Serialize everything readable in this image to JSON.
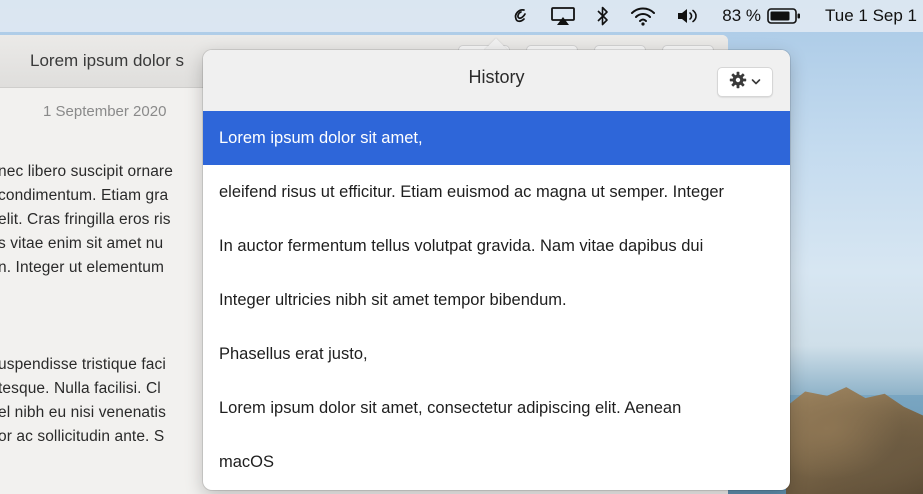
{
  "menubar": {
    "icons": [
      "clipboard-app-icon",
      "airplay-icon",
      "bluetooth-icon",
      "wifi-icon",
      "volume-icon",
      "battery-icon"
    ],
    "battery_percent": "83 %",
    "clock": "Tue 1 Sep 1"
  },
  "document": {
    "title": "Lorem ipsum dolor s",
    "date": "1 September 2020",
    "lines": [
      "nec libero suscipit ornare",
      "condimentum. Etiam gra",
      "elit. Cras fringilla eros ris",
      "s vitae enim sit amet nu",
      "n. Integer ut elementum",
      "uspendisse tristique faci",
      "tesque. Nulla facilisi. Cl",
      "el nibh eu nisi venenatis",
      "or ac sollicitudin ante. S"
    ]
  },
  "popover": {
    "title": "History",
    "items": [
      "Lorem ipsum dolor sit amet,",
      "eleifend risus ut efficitur. Etiam euismod ac magna ut semper. Integer",
      "In auctor fermentum tellus volutpat gravida. Nam vitae dapibus dui",
      "Integer ultricies nibh sit amet tempor bibendum.",
      "Phasellus erat justo,",
      "Lorem ipsum dolor sit amet, consectetur adipiscing elit. Aenean",
      "macOS"
    ],
    "selected_index": 0
  },
  "colors": {
    "selection": "#2e66d9",
    "menubar": "#dee8f2"
  }
}
